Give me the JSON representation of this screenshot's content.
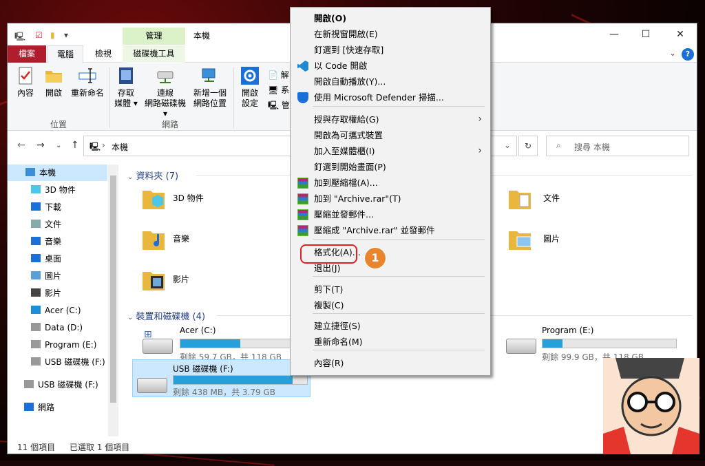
{
  "window": {
    "title": "本機",
    "manage_label": "管理",
    "controls": {
      "minimize": "—",
      "maximize": "☐",
      "close": "✕"
    }
  },
  "tabs": {
    "file": "檔案",
    "computer": "電腦",
    "view": "檢視",
    "drive_tools": "磁碟機工具"
  },
  "ribbon": {
    "properties": "內容",
    "open": "開啟",
    "rename": "重新命名",
    "group_location": "位置",
    "access_media_1": "存取",
    "access_media_2": "媒體 ▾",
    "map_drive_1": "連線",
    "map_drive_2": "網路磁碟機 ▾",
    "add_location_1": "新增一個",
    "add_location_2": "網路位置",
    "group_network": "網路",
    "open_settings_1": "開啟",
    "open_settings_2": "設定",
    "uninstall": "解",
    "system": "系",
    "manage": "管"
  },
  "address": {
    "path": "本機",
    "search_placeholder": "搜尋 本機"
  },
  "sidebar": {
    "items": [
      {
        "label": "本機",
        "icon": "pc-icon"
      },
      {
        "label": "3D 物件",
        "icon": "cube-icon"
      },
      {
        "label": "下載",
        "icon": "download-icon"
      },
      {
        "label": "文件",
        "icon": "document-icon"
      },
      {
        "label": "音樂",
        "icon": "music-icon"
      },
      {
        "label": "桌面",
        "icon": "desktop-icon"
      },
      {
        "label": "圖片",
        "icon": "picture-icon"
      },
      {
        "label": "影片",
        "icon": "video-icon"
      },
      {
        "label": "Acer (C:)",
        "icon": "windows-drive-icon"
      },
      {
        "label": "Data (D:)",
        "icon": "drive-icon"
      },
      {
        "label": "Program (E:)",
        "icon": "drive-icon"
      },
      {
        "label": "USB 磁碟機 (F:)",
        "icon": "usb-drive-icon"
      },
      {
        "label": "USB 磁碟機 (F:)",
        "icon": "usb-drive-icon"
      },
      {
        "label": "網路",
        "icon": "network-icon"
      }
    ]
  },
  "main": {
    "folders_header": "資料夾 (7)",
    "folders": [
      {
        "name": "3D 物件"
      },
      {
        "name": "文件"
      },
      {
        "name": "音樂"
      },
      {
        "name": "圖片"
      },
      {
        "name": "影片"
      }
    ],
    "devices_header": "裝置和磁碟機 (4)",
    "drives": [
      {
        "name": "Acer (C:)",
        "info": "剩餘 59.7 GB，共 118 GB",
        "used_fraction": 0.49
      },
      {
        "name": "Program (E:)",
        "info": "剩餘 99.9 GB，共 118 GB",
        "used_fraction": 0.15
      },
      {
        "name": "USB 磁碟機 (F:)",
        "info": "剩餘 438 MB，共 3.79 GB",
        "used_fraction": 0.89
      }
    ]
  },
  "status": {
    "count": "11 個項目",
    "selected": "已選取 1 個項目"
  },
  "context_menu": {
    "items": [
      {
        "label": "開啟(O)",
        "bold": true
      },
      {
        "label": "在新視窗開啟(E)"
      },
      {
        "label": "釘選到 [快速存取]"
      },
      {
        "label": "以 Code 開啟",
        "icon": "vscode-icon"
      },
      {
        "label": "開啟自動播放(Y)..."
      },
      {
        "label": "使用 Microsoft Defender 掃描...",
        "icon": "defender-icon"
      },
      {
        "label": "授與存取權給(G)",
        "submenu": true
      },
      {
        "label": "開啟為可攜式裝置"
      },
      {
        "label": "加入至媒體櫃(I)",
        "submenu": true
      },
      {
        "label": "釘選到開始畫面(P)"
      },
      {
        "label": "加到壓縮檔(A)...",
        "icon": "winrar-icon"
      },
      {
        "label": "加到 \"Archive.rar\"(T)",
        "icon": "winrar-icon"
      },
      {
        "label": "壓縮並發郵件...",
        "icon": "winrar-icon"
      },
      {
        "label": "壓縮成 \"Archive.rar\" 並發郵件",
        "icon": "winrar-icon"
      },
      {
        "label": "格式化(A)..."
      },
      {
        "label": "退出(J)"
      },
      {
        "label": "剪下(T)"
      },
      {
        "label": "複製(C)"
      },
      {
        "label": "建立捷徑(S)"
      },
      {
        "label": "重新命名(M)"
      },
      {
        "label": "內容(R)"
      }
    ],
    "badge": "1",
    "accent": "#e02020",
    "badge_color": "#e8852e"
  }
}
